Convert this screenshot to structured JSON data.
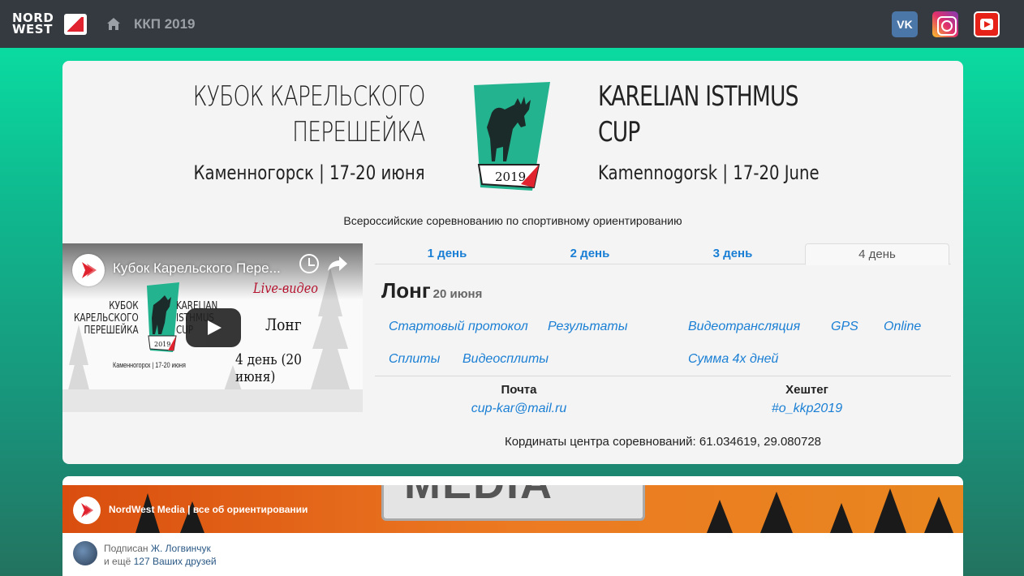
{
  "nav": {
    "brand_line1": "NORD",
    "brand_line2": "WEST",
    "breadcrumb": "ККП 2019",
    "social": [
      {
        "name": "vk",
        "label": "VK"
      },
      {
        "name": "instagram"
      },
      {
        "name": "youtube"
      }
    ]
  },
  "header": {
    "title_ru_line1": "Кубок Карельского",
    "title_ru_line2": "Перешейка",
    "subtitle_ru": "Каменногорск | 17-20 июня",
    "title_en_line1": "Karelian Isthmus",
    "title_en_line2": "Cup",
    "subtitle_en": "Kamennogorsk | 17-20 June",
    "logo_year": "2019",
    "tagline": "Всероссийские соревнованию по спортивному ориентированию"
  },
  "video": {
    "title": "Кубок Карельского Пере...",
    "live": "Live-видео",
    "stage": "Лонг",
    "day": "4 день (20 июня)",
    "ru_line1": "КУБОК",
    "ru_line2": "КАРЕЛЬСКОГО",
    "ru_line3": "ПЕРЕШЕЙКА",
    "en_line1": "KARELIAN",
    "en_line2": "ISTHMUS",
    "en_line3": "CUP",
    "logo_year": "2019",
    "city": "Каменногорск | 17-20 июня"
  },
  "tabs": [
    {
      "label": "1 день"
    },
    {
      "label": "2 день"
    },
    {
      "label": "3 день"
    },
    {
      "label": "4 день",
      "active": true
    }
  ],
  "event": {
    "title": "Лонг",
    "date": "20 июня"
  },
  "links": {
    "start_protocol": "Стартовый протокол",
    "results": "Результаты",
    "video_stream": "Видеотрансляция",
    "gps": "GPS",
    "online": "Online",
    "splits": "Сплиты",
    "video_splits": "Видеосплиты",
    "sum_4_days": "Сумма 4х дней"
  },
  "contacts": {
    "mail_label": "Почта",
    "mail_value": "cup-kar@mail.ru",
    "hashtag_label": "Хештег",
    "hashtag_value": "#o_kkp2019"
  },
  "coords_text": "Кординаты центра соревнований: 61.034619, 29.080728",
  "widget": {
    "banner_word": "MEDIA",
    "group_name": "NordWest Media | все об ориентировании",
    "subscribed_prefix": "Подписан",
    "subscribed_name": "Ж. Логвинчук",
    "friends_prefix": "и ещё",
    "friends_link": "127 Ваших друзей"
  },
  "colors": {
    "accent_link": "#1a7fd4",
    "nav_bg": "#343a40",
    "logo_green": "#23b48f",
    "logo_red": "#e0232e"
  }
}
